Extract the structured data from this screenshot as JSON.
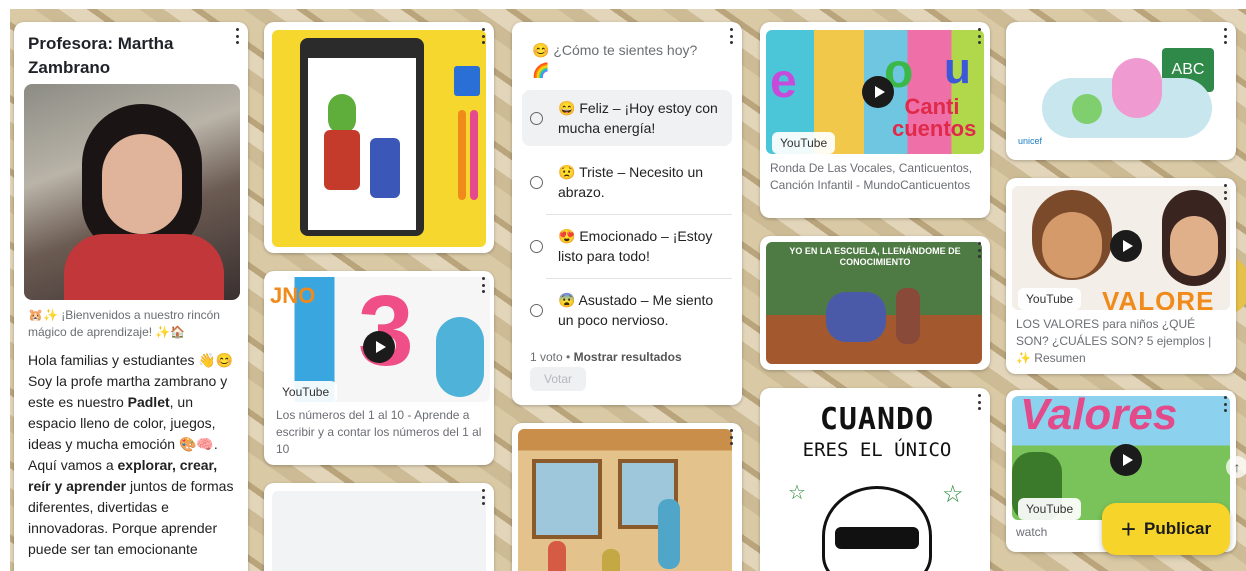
{
  "profile_card": {
    "title": "Profesora: Martha Zambrano",
    "photo_caption": "🐹✨ ¡Bienvenidos a nuestro rincón mágico de aprendizaje! ✨🏠",
    "greeting": "Hola familias y estudiantes 👋😊",
    "p1": "Soy la profe martha zambrano y este es nuestro ",
    "padlet": "Padlet",
    "p2": ", un espacio lleno de color, juegos, ideas y mucha emoción 🎨🧠. Aquí vamos a ",
    "verbs": "explorar, crear, reír y aprender",
    "p3": " juntos de formas diferentes, divertidas e innovadoras. Porque aprender puede ser tan emocionante"
  },
  "poll": {
    "question": "😊 ¿Cómo te sientes hoy? 🌈",
    "options": [
      {
        "label": "😄 Feliz – ¡Hoy estoy con mucha energía!"
      },
      {
        "label": "😟 Triste – Necesito un abrazo."
      },
      {
        "label": "😍 Emocionado – ¡Estoy listo para todo!"
      },
      {
        "label": "😨 Asustado – Me siento un poco nervioso."
      }
    ],
    "votes": "1 voto",
    "dot": "•",
    "show_results": "Mostrar resultados",
    "vote_button": "Votar"
  },
  "numbers_video": {
    "badge": "YouTube",
    "caption": "Los números del 1 al 10 - Aprende a escribir y a contar los números del 1 al 10",
    "thumb_text": "JNO"
  },
  "vocales_video": {
    "badge": "YouTube",
    "caption": "Ronda De Las Vocales, Canticuentos, Canción Infantil - MundoCanticuentos",
    "thumb_logo": "Canti cuentos"
  },
  "escuela_video": {
    "thumb_text": "YO EN LA ESCUELA, LLENÁNDOME DE CONOCIMIENTO"
  },
  "valores_video": {
    "badge": "YouTube",
    "caption": "LOS VALORES para niños ¿QUÉ SON? ¿CUÁLES SON? 5 ejemplos |",
    "summary": "✨ Resumen",
    "thumb_text": "VALORE"
  },
  "valores2_video": {
    "badge": "YouTube",
    "caption": "watch",
    "thumb_text": "Valores"
  },
  "cuando_card": {
    "line1": "CUANDO",
    "line2": "ERES EL ÚNICO"
  },
  "unicef_card": {
    "logo": "unicef",
    "corner": "ABC"
  },
  "publish_button": {
    "label": "Publicar",
    "icon": "plus-icon"
  },
  "scroll_top": {
    "icon": "arrow-up-icon"
  },
  "colors": {
    "accent": "#f7d42a",
    "card": "#ffffff"
  }
}
